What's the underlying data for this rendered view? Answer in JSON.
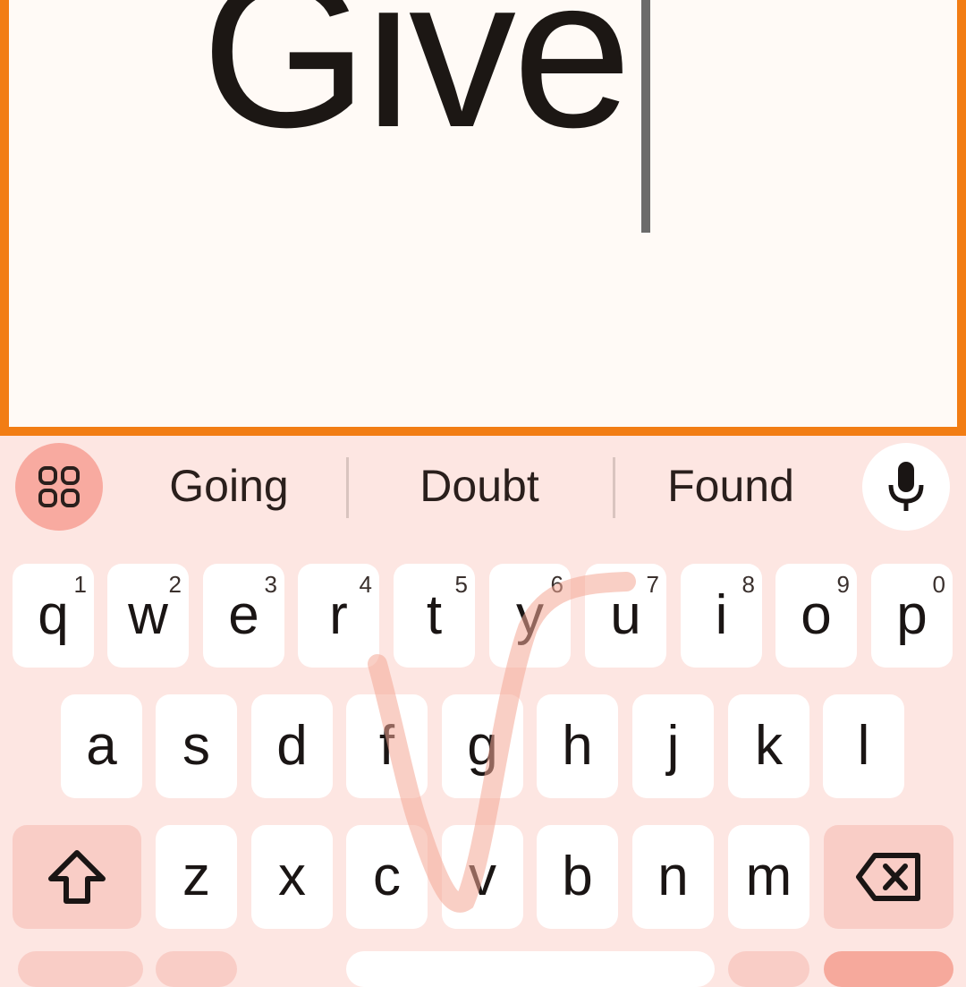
{
  "editor": {
    "text": "Give"
  },
  "suggestions": [
    "Going",
    "Doubt",
    "Found"
  ],
  "keys": {
    "row1": [
      {
        "char": "q",
        "num": "1"
      },
      {
        "char": "w",
        "num": "2"
      },
      {
        "char": "e",
        "num": "3"
      },
      {
        "char": "r",
        "num": "4"
      },
      {
        "char": "t",
        "num": "5"
      },
      {
        "char": "y",
        "num": "6"
      },
      {
        "char": "u",
        "num": "7"
      },
      {
        "char": "i",
        "num": "8"
      },
      {
        "char": "o",
        "num": "9"
      },
      {
        "char": "p",
        "num": "0"
      }
    ],
    "row2": [
      "a",
      "s",
      "d",
      "f",
      "g",
      "h",
      "j",
      "k",
      "l"
    ],
    "row3": [
      "z",
      "x",
      "c",
      "v",
      "b",
      "n",
      "m"
    ]
  },
  "icons": {
    "apps": "apps-grid-icon",
    "mic": "microphone-icon",
    "shift": "shift-arrow-icon",
    "backspace": "backspace-icon"
  },
  "colors": {
    "accent_border": "#f27d14",
    "keyboard_bg": "#fde6e2",
    "modifier_key": "#f9cdc6",
    "apps_button": "#f8aaa0"
  }
}
